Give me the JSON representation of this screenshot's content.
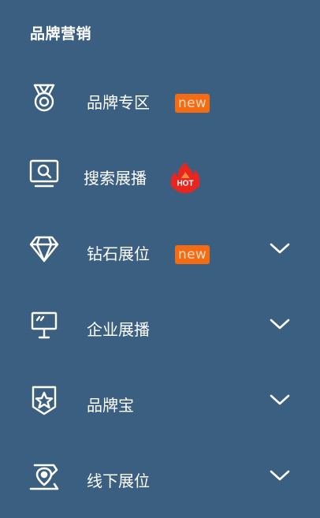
{
  "section": {
    "title": "品牌营销"
  },
  "menu": {
    "items": [
      {
        "label": "品牌专区",
        "badge": "new",
        "icon": "medal-icon",
        "expandable": false
      },
      {
        "label": "搜索展播",
        "badge": "HOT",
        "icon": "search-monitor-icon",
        "expandable": false
      },
      {
        "label": "钻石展位",
        "badge": "new",
        "icon": "diamond-icon",
        "expandable": true
      },
      {
        "label": "企业展播",
        "badge": "",
        "icon": "billboard-icon",
        "expandable": true
      },
      {
        "label": "品牌宝",
        "badge": "",
        "icon": "star-shield-icon",
        "expandable": true
      },
      {
        "label": "线下展位",
        "badge": "",
        "icon": "location-pin-icon",
        "expandable": true
      }
    ]
  },
  "colors": {
    "background": "#3b5f80",
    "new_badge": "#f36c13",
    "hot_badge": "#e8251e"
  }
}
